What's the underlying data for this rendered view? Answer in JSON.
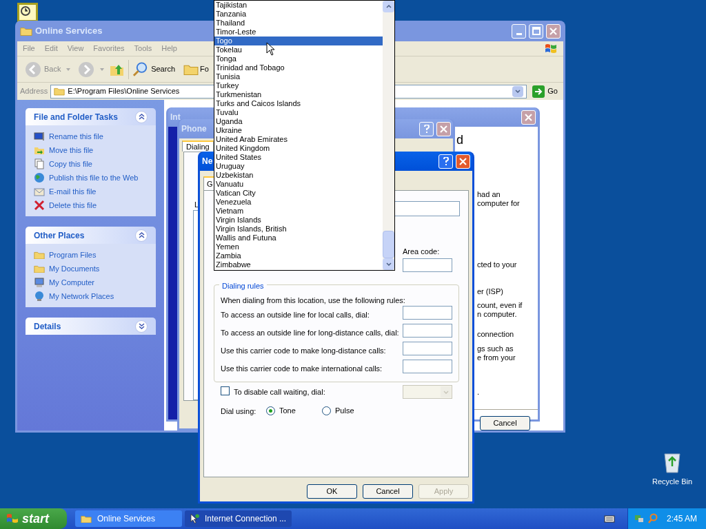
{
  "explorer": {
    "title": "Online Services",
    "menu": [
      "File",
      "Edit",
      "View",
      "Favorites",
      "Tools",
      "Help"
    ],
    "toolbar": {
      "back": "Back",
      "search": "Search",
      "folders": "Fo"
    },
    "address": {
      "label": "Address",
      "value": "E:\\Program Files\\Online Services",
      "go": "Go"
    },
    "panels": [
      {
        "title": "File and Folder Tasks",
        "expanded": true,
        "items": [
          "Rename this file",
          "Move this file",
          "Copy this file",
          "Publish this file to the Web",
          "E-mail this file",
          "Delete this file"
        ]
      },
      {
        "title": "Other Places",
        "expanded": true,
        "items": [
          "Program Files",
          "My Documents",
          "My Computer",
          "My Network Places"
        ]
      },
      {
        "title": "Details",
        "expanded": false
      }
    ]
  },
  "wizard": {
    "title": "Int",
    "heading": "d",
    "fragments": [
      "had an",
      "computer for",
      "cted to your",
      "er (ISP)",
      "count, even if",
      "n computer.",
      "connection",
      "gs such as",
      "e from your",
      "."
    ],
    "cancel": "Cancel"
  },
  "phone_dialog": {
    "title": "Phone",
    "tab": "Dialing",
    "label": "L"
  },
  "new_location": {
    "title": "Ne",
    "tab": "G",
    "area_code_label": "Area code:",
    "dialing_rules": {
      "title": "Dialing rules",
      "intro": "When dialing from this location, use the following rules:",
      "rows": [
        "To access an outside line for local calls, dial:",
        "To access an outside line for long-distance calls, dial:",
        "Use this carrier code to make long-distance calls:",
        "Use this carrier code to make international calls:"
      ]
    },
    "call_waiting": {
      "label": "To disable call waiting, dial:",
      "checked": false
    },
    "dial_using": {
      "label": "Dial using:",
      "options": [
        {
          "label": "Tone",
          "selected": true
        },
        {
          "label": "Pulse",
          "selected": false
        }
      ]
    },
    "buttons": [
      {
        "label": "OK",
        "disabled": false
      },
      {
        "label": "Cancel",
        "disabled": false
      },
      {
        "label": "Apply",
        "disabled": true
      }
    ]
  },
  "country_list": [
    {
      "label": "Tajikistan",
      "selected": false
    },
    {
      "label": "Tanzania",
      "selected": false
    },
    {
      "label": "Thailand",
      "selected": false
    },
    {
      "label": "Timor-Leste",
      "selected": false
    },
    {
      "label": "Togo",
      "selected": true
    },
    {
      "label": "Tokelau",
      "selected": false
    },
    {
      "label": "Tonga",
      "selected": false
    },
    {
      "label": "Trinidad and Tobago",
      "selected": false
    },
    {
      "label": "Tunisia",
      "selected": false
    },
    {
      "label": "Turkey",
      "selected": false
    },
    {
      "label": "Turkmenistan",
      "selected": false
    },
    {
      "label": "Turks and Caicos Islands",
      "selected": false
    },
    {
      "label": "Tuvalu",
      "selected": false
    },
    {
      "label": "Uganda",
      "selected": false
    },
    {
      "label": "Ukraine",
      "selected": false
    },
    {
      "label": "United Arab Emirates",
      "selected": false
    },
    {
      "label": "United Kingdom",
      "selected": false
    },
    {
      "label": "United States",
      "selected": false
    },
    {
      "label": "Uruguay",
      "selected": false
    },
    {
      "label": "Uzbekistan",
      "selected": false
    },
    {
      "label": "Vanuatu",
      "selected": false
    },
    {
      "label": "Vatican City",
      "selected": false
    },
    {
      "label": "Venezuela",
      "selected": false
    },
    {
      "label": "Vietnam",
      "selected": false
    },
    {
      "label": "Virgin Islands",
      "selected": false
    },
    {
      "label": "Virgin Islands, British",
      "selected": false
    },
    {
      "label": "Wallis and Futuna",
      "selected": false
    },
    {
      "label": "Yemen",
      "selected": false
    },
    {
      "label": "Zambia",
      "selected": false
    },
    {
      "label": "Zimbabwe",
      "selected": false
    }
  ],
  "recycle_bin": "Recycle Bin",
  "taskbar": {
    "start": "start",
    "tasks": [
      {
        "label": "Online Services",
        "selected": false
      },
      {
        "label": "Internet Connection ...",
        "selected": true
      }
    ],
    "clock": "2:45 AM"
  }
}
